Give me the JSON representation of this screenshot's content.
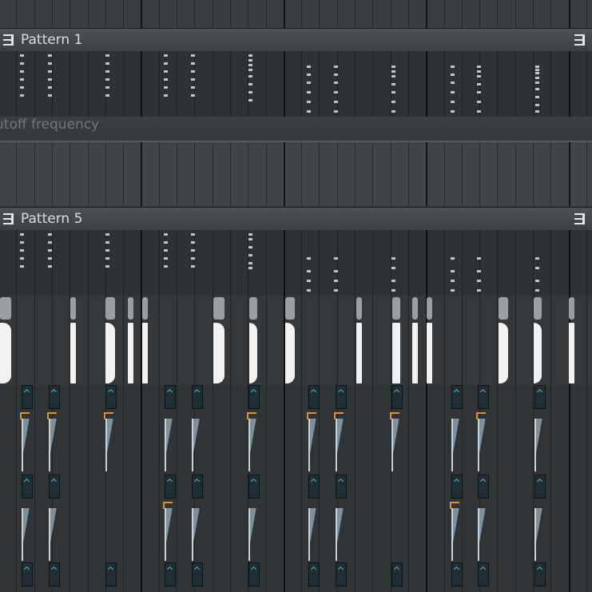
{
  "clips": [
    {
      "label": "Pattern 1"
    },
    {
      "label": "Pattern 5"
    }
  ],
  "automation": {
    "label": "utoff frequency"
  },
  "icons": {
    "clip_menu": "clip-menu-icon",
    "clip_handle": "clip-handle-icon"
  },
  "colors": {
    "background": "#34383b",
    "clip_header": "#44494d",
    "note_tick": "#bfc4c6",
    "waveform": "#f2f2f2",
    "envelope": "#7d909c",
    "accent_orange": "#e0902c",
    "accent_teal": "#5fb0c8"
  }
}
